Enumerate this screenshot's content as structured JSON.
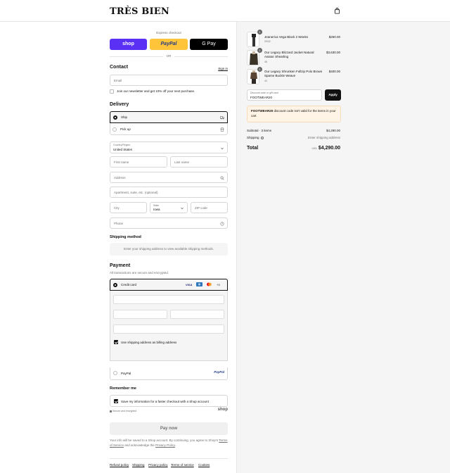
{
  "brand": "TRÈS BIEN",
  "express": {
    "title": "Express checkout",
    "shop": "shop",
    "paypal": "PayPal",
    "gpay": "G Pay",
    "or": "OR"
  },
  "contact": {
    "title": "Contact",
    "signin": "Sign in",
    "email_placeholder": "Email",
    "newsletter": "Join our newsletter and get 10% off your next purchase."
  },
  "delivery": {
    "title": "Delivery",
    "ship": "Ship",
    "pickup": "Pick up",
    "country_label": "Country/Region",
    "country_value": "United States",
    "first_name": "First name",
    "last_name": "Last name",
    "address": "Address",
    "apartment": "Apartment, suite, etc. (optional)",
    "city": "City",
    "state_label": "State",
    "state_value": "Iowa",
    "zip": "ZIP code",
    "phone": "Phone"
  },
  "shipping": {
    "title": "Shipping method",
    "notice": "Enter your shipping address to view available shipping methods."
  },
  "payment": {
    "title": "Payment",
    "subtitle": "All transactions are secure and encrypted.",
    "credit_card": "Credit card",
    "card_visa": "VISA",
    "more_cards": "+3",
    "billing_same": "Use shipping address as billing address",
    "paypal": "PayPal",
    "paypal_logo": "PayPal"
  },
  "remember": {
    "title": "Remember me",
    "save": "Save my information for a faster checkout with a Shop account",
    "secure": "Secure and encrypted",
    "shop_logo": "shop"
  },
  "pay_now": "Pay now",
  "legal": {
    "pre": "Your info will be saved to a Shop account. By continuing, you agree to Shop's",
    "terms": "Terms of Service",
    "mid": "and acknowledge the",
    "privacy": "Privacy Policy",
    "end": "."
  },
  "footer_links": [
    "Refund policy",
    "Shipping",
    "Privacy policy",
    "Terms of service",
    "Cookies"
  ],
  "cart": {
    "items": [
      {
        "qty": "1",
        "name": "Jeanerica Vega Black 2 Weeks",
        "variant": "29/32",
        "price": "$260.00"
      },
      {
        "qty": "1",
        "name": "Our Legacy Blizzard Jacket Natural Aviator Shearling",
        "variant": "46",
        "price": "$3,630.00"
      },
      {
        "qty": "1",
        "name": "Our Legacy Shrunken Fullzip Polo Brown Sparse Buckle Weave",
        "variant": "44",
        "price": "$400.00"
      }
    ],
    "discount_label": "Discount code or gift card",
    "discount_value": "FOOTWEAR20",
    "apply": "Apply",
    "warning_code": "FOOTWEAR20",
    "warning_text": " discount code isn't valid for the items in your cart",
    "subtotal_label": "Subtotal · 3 items",
    "subtotal_value": "$4,290.00",
    "shipping_label": "Shipping",
    "shipping_value": "Enter shipping address",
    "total_label": "Total",
    "total_currency": "USD",
    "total_value": "$4,290.00"
  },
  "colors": {
    "shop_purple": "#5a31f4",
    "paypal_yellow": "#ffc439",
    "warning_bg": "#fff4e5"
  }
}
